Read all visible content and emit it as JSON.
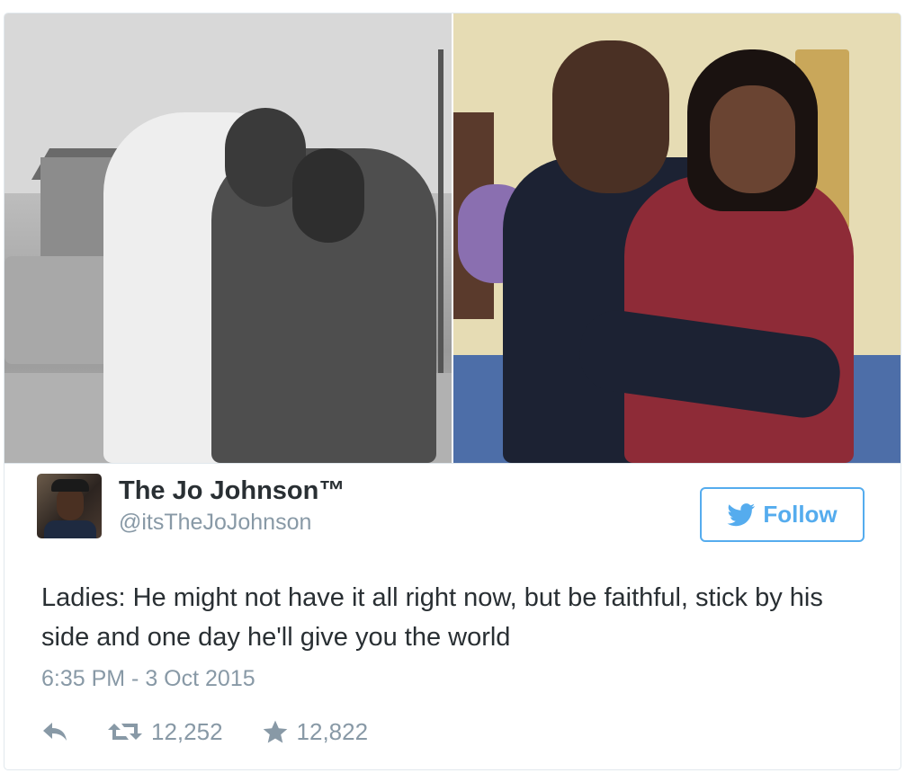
{
  "tweet": {
    "author": {
      "display_name": "The Jo Johnson™",
      "handle": "@itsTheJoJohnson"
    },
    "follow_label": "Follow",
    "text": "Ladies: He might not have it all right now, but be faithful, stick by his side and one day he'll give you the world",
    "timestamp": "6:35 PM - 3 Oct 2015",
    "actions": {
      "retweets": "12,252",
      "likes": "12,822"
    }
  },
  "icons": {
    "reply": "reply-icon",
    "retweet": "retweet-icon",
    "like": "star-icon",
    "follow": "twitter-bird-icon"
  },
  "colors": {
    "accent": "#55acee",
    "text": "#292f33",
    "muted": "#8899a6",
    "border": "#e1e8ed"
  }
}
